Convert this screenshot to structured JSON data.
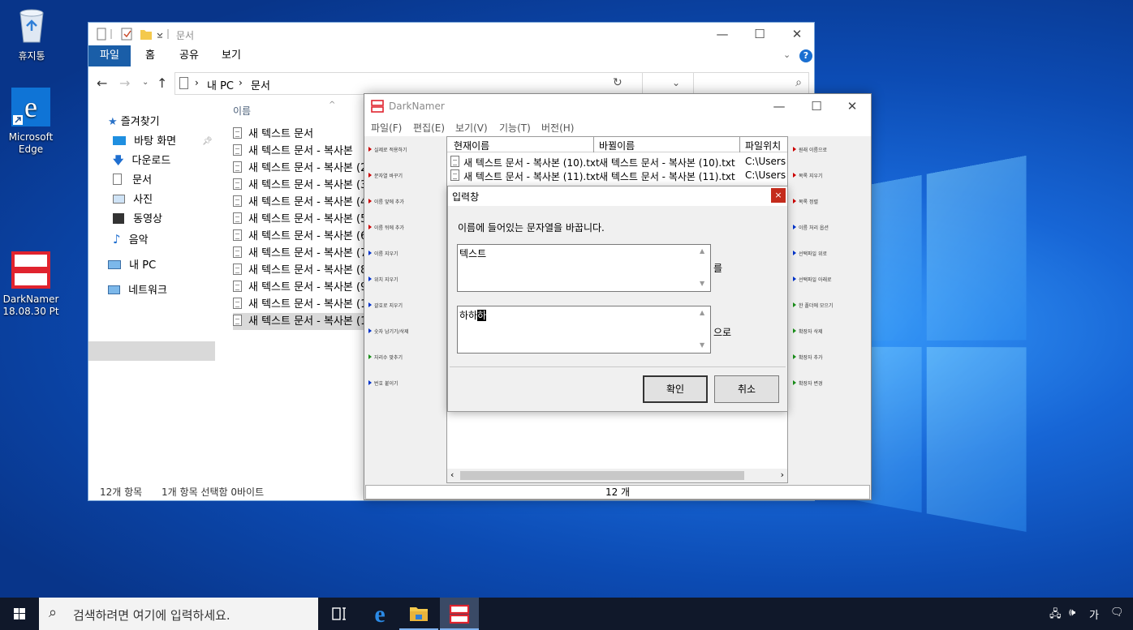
{
  "desktop": {
    "icons": [
      {
        "label": "휴지통"
      },
      {
        "label": "Microsoft Edge"
      },
      {
        "label": "DarkNamer 18.08.30 Pt"
      }
    ]
  },
  "explorer": {
    "title": "문서",
    "ribbon_tabs": [
      "파일",
      "홈",
      "공유",
      "보기"
    ],
    "breadcrumb": [
      "내 PC",
      "문서"
    ],
    "column_name": "이름",
    "nav": {
      "quick_access": "즐겨찾기",
      "items": [
        "바탕 화면",
        "다운로드",
        "문서",
        "사진",
        "동영상",
        "음악"
      ],
      "this_pc": "내 PC",
      "network": "네트워크"
    },
    "files": [
      "새 텍스트 문서",
      "새 텍스트 문서 - 복사본",
      "새 텍스트 문서 - 복사본 (2",
      "새 텍스트 문서 - 복사본 (3",
      "새 텍스트 문서 - 복사본 (4",
      "새 텍스트 문서 - 복사본 (5",
      "새 텍스트 문서 - 복사본 (6",
      "새 텍스트 문서 - 복사본 (7",
      "새 텍스트 문서 - 복사본 (8",
      "새 텍스트 문서 - 복사본 (9",
      "새 텍스트 문서 - 복사본 (1",
      "새 텍스트 문서 - 복사본 (1"
    ],
    "status_count": "12개 항목",
    "status_selected": "1개 항목 선택함 0바이트"
  },
  "darknamer": {
    "title": "DarkNamer",
    "menu": [
      "파일(F)",
      "편집(E)",
      "보기(V)",
      "기능(T)",
      "버전(H)"
    ],
    "columns": [
      "현재이름",
      "바뀔이름",
      "파일위치"
    ],
    "rows": [
      {
        "current": "새 텍스트 문서 - 복사본 (10).txt",
        "new": "새 텍스트 문서 - 복사본 (10).txt",
        "path": "C:\\Users"
      },
      {
        "current": "새 텍스트 문서 - 복사본 (11).txt",
        "new": "새 텍스트 문서 - 복사본 (11).txt",
        "path": "C:\\Users"
      }
    ],
    "left_buttons": [
      "실제로 적용하기",
      "문자열 바꾸기",
      "이름 앞에 추가",
      "이름 뒤에 추가",
      "이름 지우기",
      "위치 지우기",
      "괄호로 지우기",
      "숫자 남기기/삭제",
      "자리수 맞추기",
      "번호 붙이기"
    ],
    "right_buttons": [
      "원래 이름으로",
      "목록 지우기",
      "목록 정렬",
      "이름 처리 옵션",
      "선택파일 위로",
      "선택파일 아래로",
      "한 폴더에 모으기",
      "확장자 삭제",
      "확장자 추가",
      "확장자 변경"
    ],
    "status": "12 개"
  },
  "dialog": {
    "title": "입력창",
    "close": "×",
    "message": "이름에 들어있는 문자열을 바꿉니다.",
    "find_value": "텍스트",
    "find_suffix": "를",
    "replace_value_plain": "하하",
    "replace_value_selected": "하",
    "replace_suffix": "으로",
    "ok": "확인",
    "cancel": "취소"
  },
  "taskbar": {
    "search_placeholder": "검색하려면 여기에 입력하세요.",
    "tray_lang": "가"
  }
}
